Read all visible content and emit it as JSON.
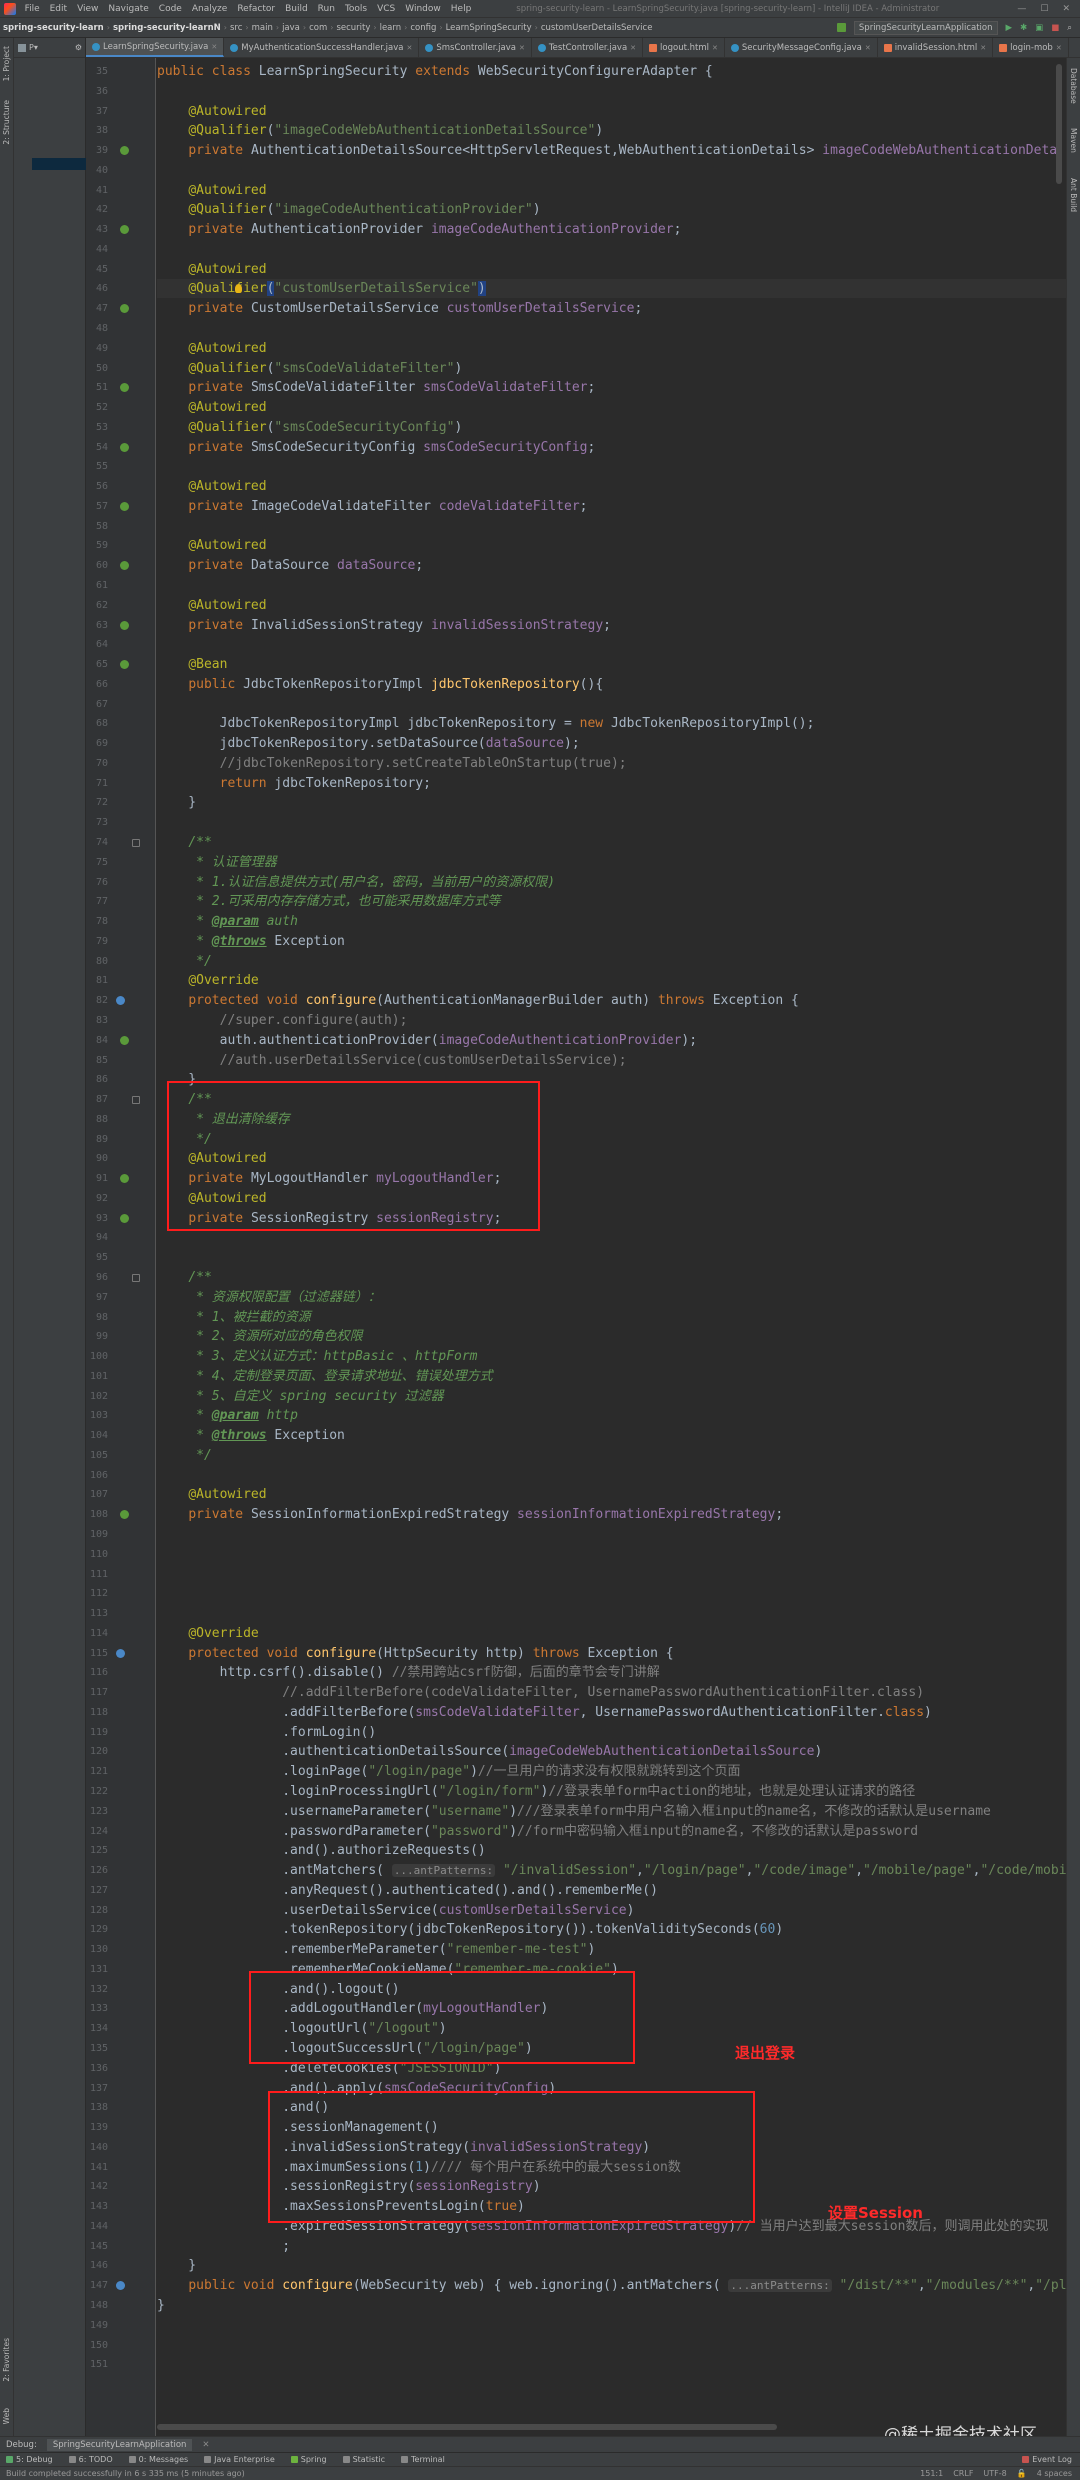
{
  "menubar": {
    "items": [
      "File",
      "Edit",
      "View",
      "Navigate",
      "Code",
      "Analyze",
      "Refactor",
      "Build",
      "Run",
      "Tools",
      "VCS",
      "Window",
      "Help"
    ],
    "window_title": "spring-security-learn - LearnSpringSecurity.java [spring-security-learn] - IntelliJ IDEA - Administrator"
  },
  "navbar": {
    "crumbs": [
      "spring-security-learn",
      "spring-security-learnN",
      "src",
      "main",
      "java",
      "com",
      "security",
      "learn",
      "config",
      "LearnSpringSecurity",
      "customUserDetailsService"
    ],
    "run_config": "SpringSecurityLearnApplication"
  },
  "tabs": [
    {
      "label": "LearnSpringSecurity.java",
      "type": "class",
      "active": true
    },
    {
      "label": "MyAuthenticationSuccessHandler.java",
      "type": "class"
    },
    {
      "label": "SmsController.java",
      "type": "class"
    },
    {
      "label": "TestController.java",
      "type": "class"
    },
    {
      "label": "logout.html",
      "type": "html"
    },
    {
      "label": "SecurityMessageConfig.java",
      "type": "class"
    },
    {
      "label": "invalidSession.html",
      "type": "html"
    },
    {
      "label": "login-mob",
      "type": "html"
    }
  ],
  "side_labels": {
    "project": "1: Project",
    "structure": "2: Structure",
    "favorites": "2: Favorites",
    "web": "Web"
  },
  "right_labels": {
    "database": "Database",
    "maven": "Maven",
    "ant": "Ant Build"
  },
  "code": {
    "header_line": "public class LearnSpringSecurity extends WebSecurityConfigurerAdapter {",
    "numbers": {
      "s": "\"/dist/**\"",
      "t": "\"/modules/**\"",
      "u": "\"/plugi"
    }
  },
  "annotations": {
    "logout": "退出登录",
    "session": "设置Session"
  },
  "debug": {
    "label": "Debug:",
    "tab": "SpringSecurityLearnApplication"
  },
  "toolwindows": [
    "5: Debug",
    "6: TODO",
    "0: Messages",
    "Java Enterprise",
    "Spring",
    "Statistic",
    "Terminal"
  ],
  "event_log": "Event Log",
  "status": {
    "message": "Build completed successfully in 6 s 335 ms (5 minutes ago)",
    "position": "151:1",
    "line_sep": "CRLF",
    "encoding": "UTF-8",
    "indent": "4 spaces"
  },
  "watermark": "@稀土掘金技术社区"
}
